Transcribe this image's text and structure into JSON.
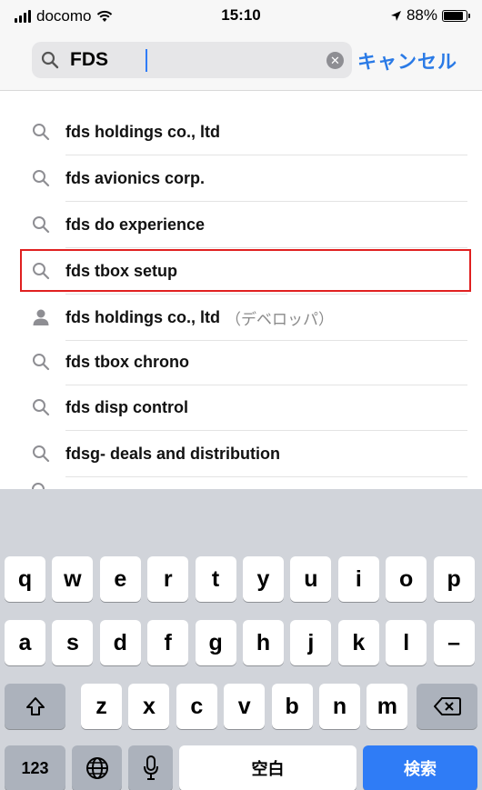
{
  "status_bar": {
    "carrier": "docomo",
    "time": "15:10",
    "battery": "88%",
    "battery_level": 0.88
  },
  "search": {
    "query": "FDS",
    "cancel_label": "キャンセル"
  },
  "suggestions": [
    {
      "label": "fds holdings co., ltd",
      "icon": "search-icon",
      "sub": ""
    },
    {
      "label": "fds avionics corp.",
      "icon": "search-icon",
      "sub": ""
    },
    {
      "label": "fds do experience",
      "icon": "search-icon",
      "sub": ""
    },
    {
      "label": "fds tbox setup",
      "icon": "search-icon",
      "sub": "",
      "highlighted": true
    },
    {
      "label": "fds holdings co., ltd",
      "icon": "person-icon",
      "sub": "（デベロッパ）"
    },
    {
      "label": "fds tbox chrono",
      "icon": "search-icon",
      "sub": ""
    },
    {
      "label": "fds disp control",
      "icon": "search-icon",
      "sub": ""
    },
    {
      "label": "fdsg- deals and distribution",
      "icon": "search-icon",
      "sub": ""
    }
  ],
  "keyboard": {
    "row1": [
      "q",
      "w",
      "e",
      "r",
      "t",
      "y",
      "u",
      "i",
      "o",
      "p"
    ],
    "row2": [
      "a",
      "s",
      "d",
      "f",
      "g",
      "h",
      "j",
      "k",
      "l",
      "–"
    ],
    "row3": [
      "z",
      "x",
      "c",
      "v",
      "b",
      "n",
      "m"
    ],
    "numbers_label": "123",
    "space_label": "空白",
    "search_label": "検索"
  },
  "colors": {
    "accent": "#2a7ae6",
    "highlight_border": "#e02020",
    "keyboard_bg": "#d1d4da"
  }
}
